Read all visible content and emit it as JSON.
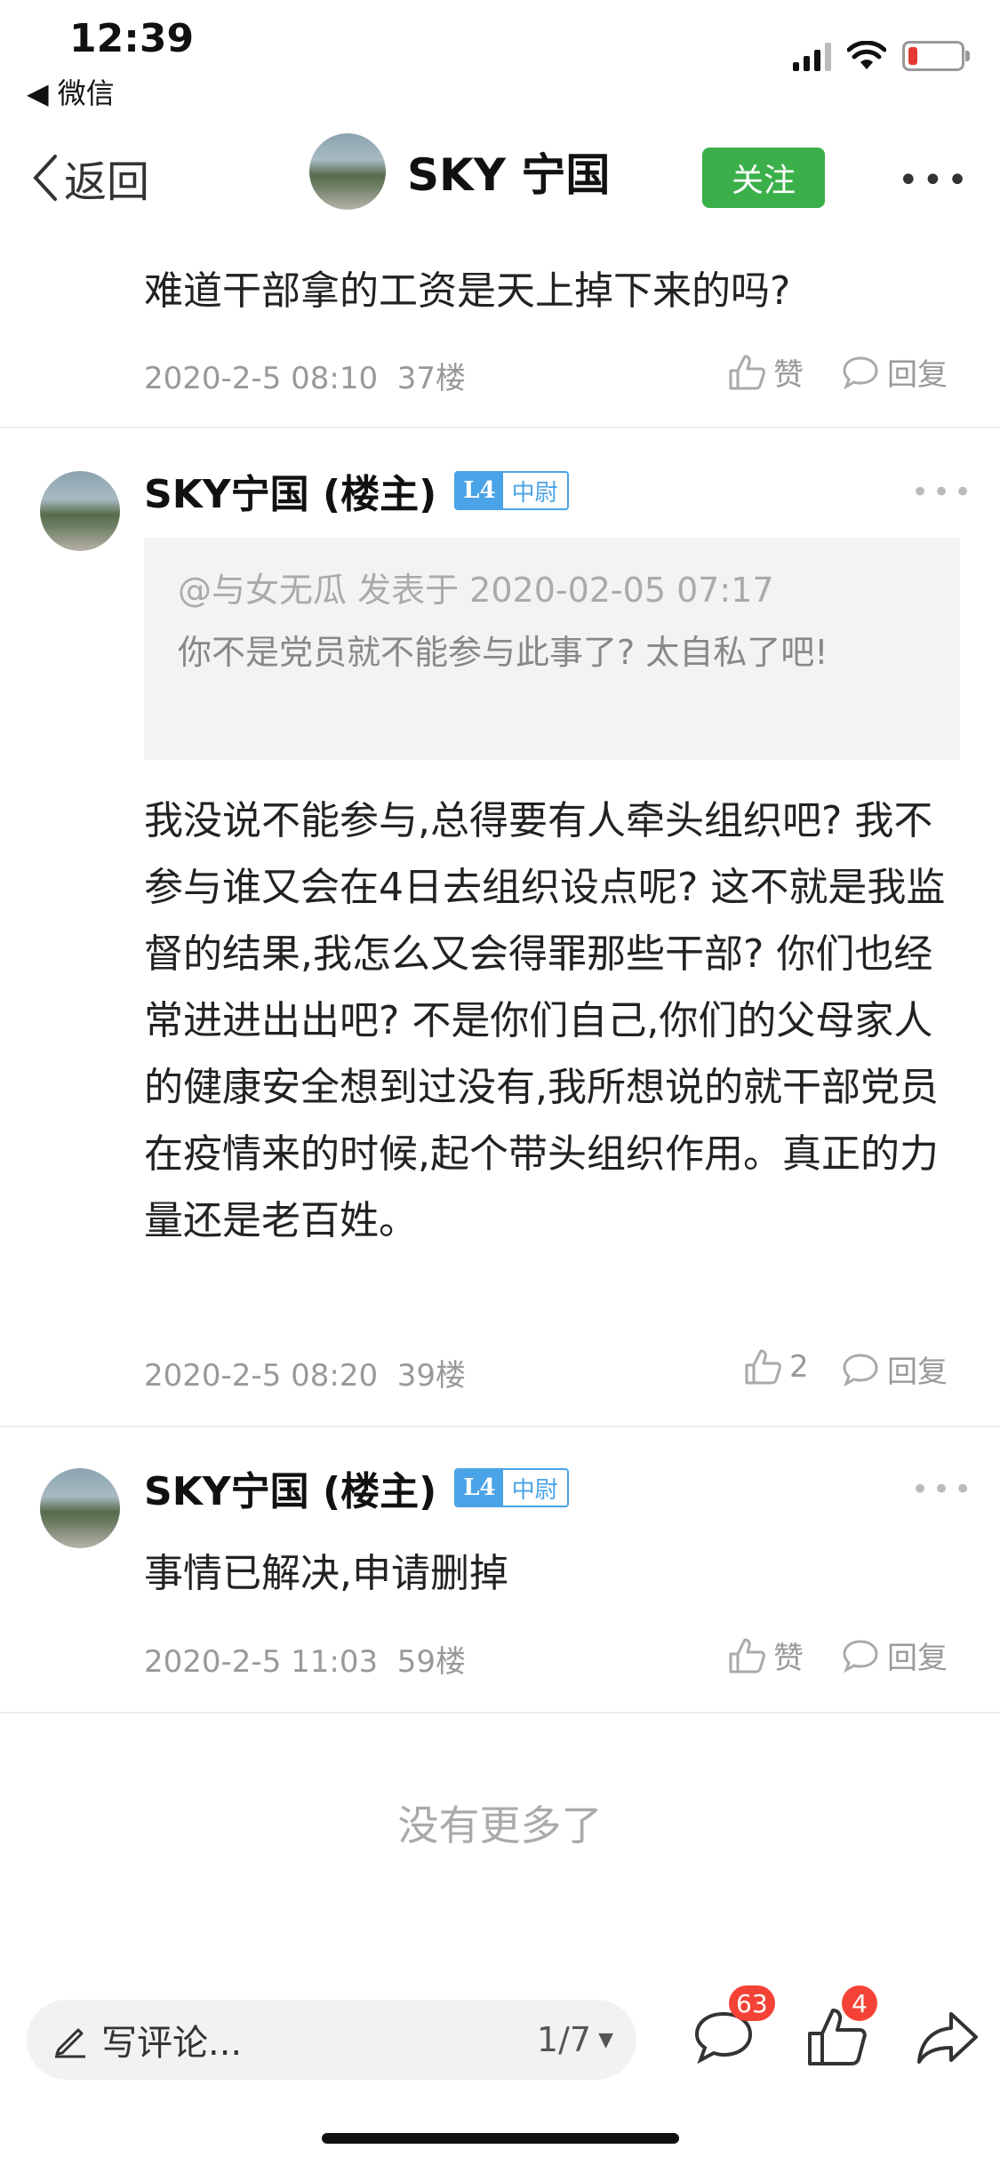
{
  "status_bar": {
    "time": "12:39",
    "back_app": "◀ 微信"
  },
  "nav": {
    "back_label": "返回",
    "title": "SKY 宁国",
    "follow_label": "关注"
  },
  "posts": [
    {
      "content": "难道干部拿的工资是天上掉下来的吗?",
      "date": "2020-2-5 08:10",
      "floor": "37楼",
      "like": "赞",
      "reply": "回复"
    },
    {
      "author": "SKY宁国 (楼主)",
      "level": "L4",
      "rank": "中尉",
      "quote_head": "@与女无瓜 发表于 2020-02-05 07:17",
      "quote_body": "你不是党员就不能参与此事了? 太自私了吧!",
      "content": "我没说不能参与,总得要有人牵头组织吧? 我不参与谁又会在4日去组织设点呢? 这不就是我监督的结果,我怎么又会得罪那些干部? 你们也经常进进出出吧? 不是你们自己,你们的父母家人的健康安全想到过没有,我所想说的就干部党员在疫情来的时候,起个带头组织作用。真正的力量还是老百姓。",
      "date": "2020-2-5 08:20",
      "floor": "39楼",
      "like": "2",
      "reply": "回复"
    },
    {
      "author": "SKY宁国 (楼主)",
      "level": "L4",
      "rank": "中尉",
      "content": "事情已解决,申请删掉",
      "date": "2020-2-5 11:03",
      "floor": "59楼",
      "like": "赞",
      "reply": "回复"
    }
  ],
  "footer": {
    "no_more": "没有更多了"
  },
  "bottom_bar": {
    "comment_placeholder": "写评论...",
    "page": "1/7",
    "comment_count": "63",
    "like_count": "4"
  },
  "colors": {
    "follow": "#3bb04a",
    "badge": "#4aa3e6",
    "notification": "#f44336"
  }
}
